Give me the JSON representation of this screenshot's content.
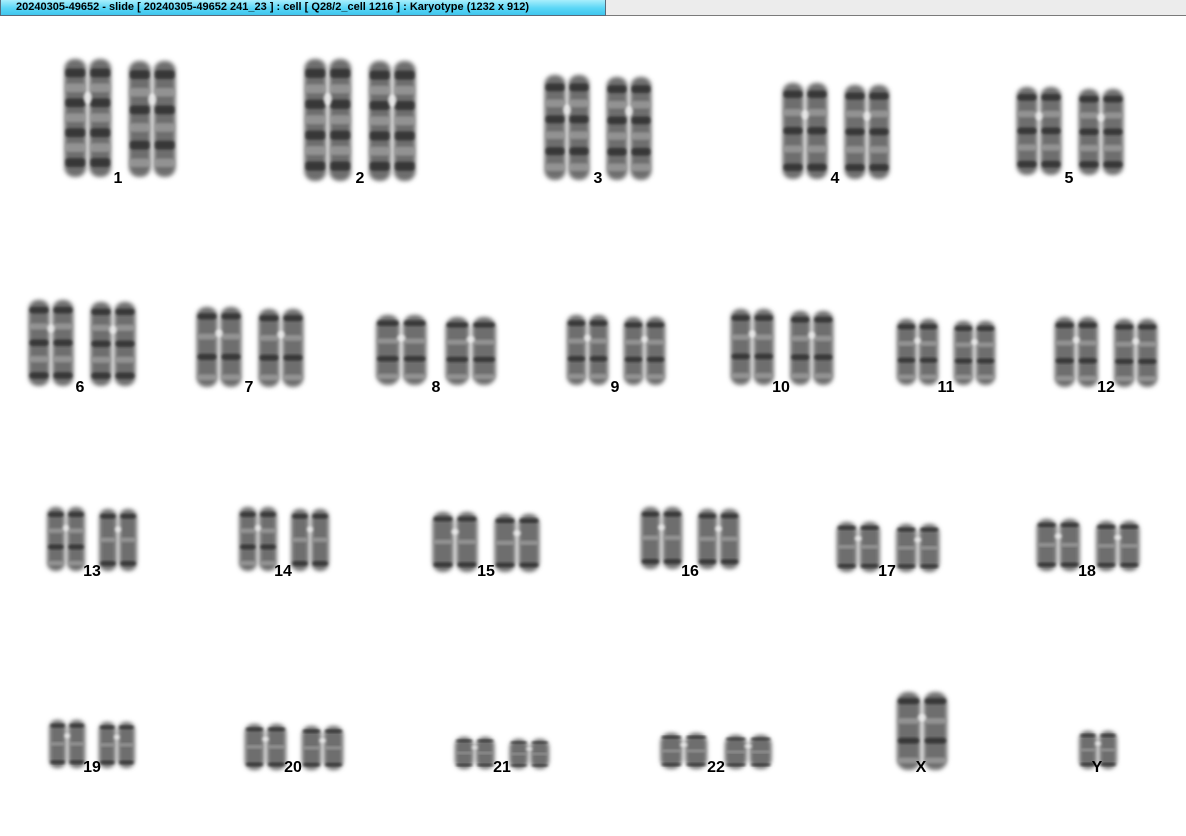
{
  "window": {
    "title": "20240305-49652 - slide [ 20240305-49652 241_23 ] : cell [ Q28/2_cell 1216 ] : Karyotype  (1232 x 912)"
  },
  "karyotype": {
    "labels": [
      "1",
      "2",
      "3",
      "4",
      "5",
      "6",
      "7",
      "8",
      "9",
      "10",
      "11",
      "12",
      "13",
      "14",
      "15",
      "16",
      "17",
      "18",
      "19",
      "20",
      "21",
      "22",
      "X",
      "Y"
    ]
  },
  "colors": {
    "chromosome_dark": "#2a2a2a",
    "chromosome_mid": "#6e6e6e",
    "chromosome_light": "#b0b0b0",
    "title_tab": "#5ad6f6"
  }
}
